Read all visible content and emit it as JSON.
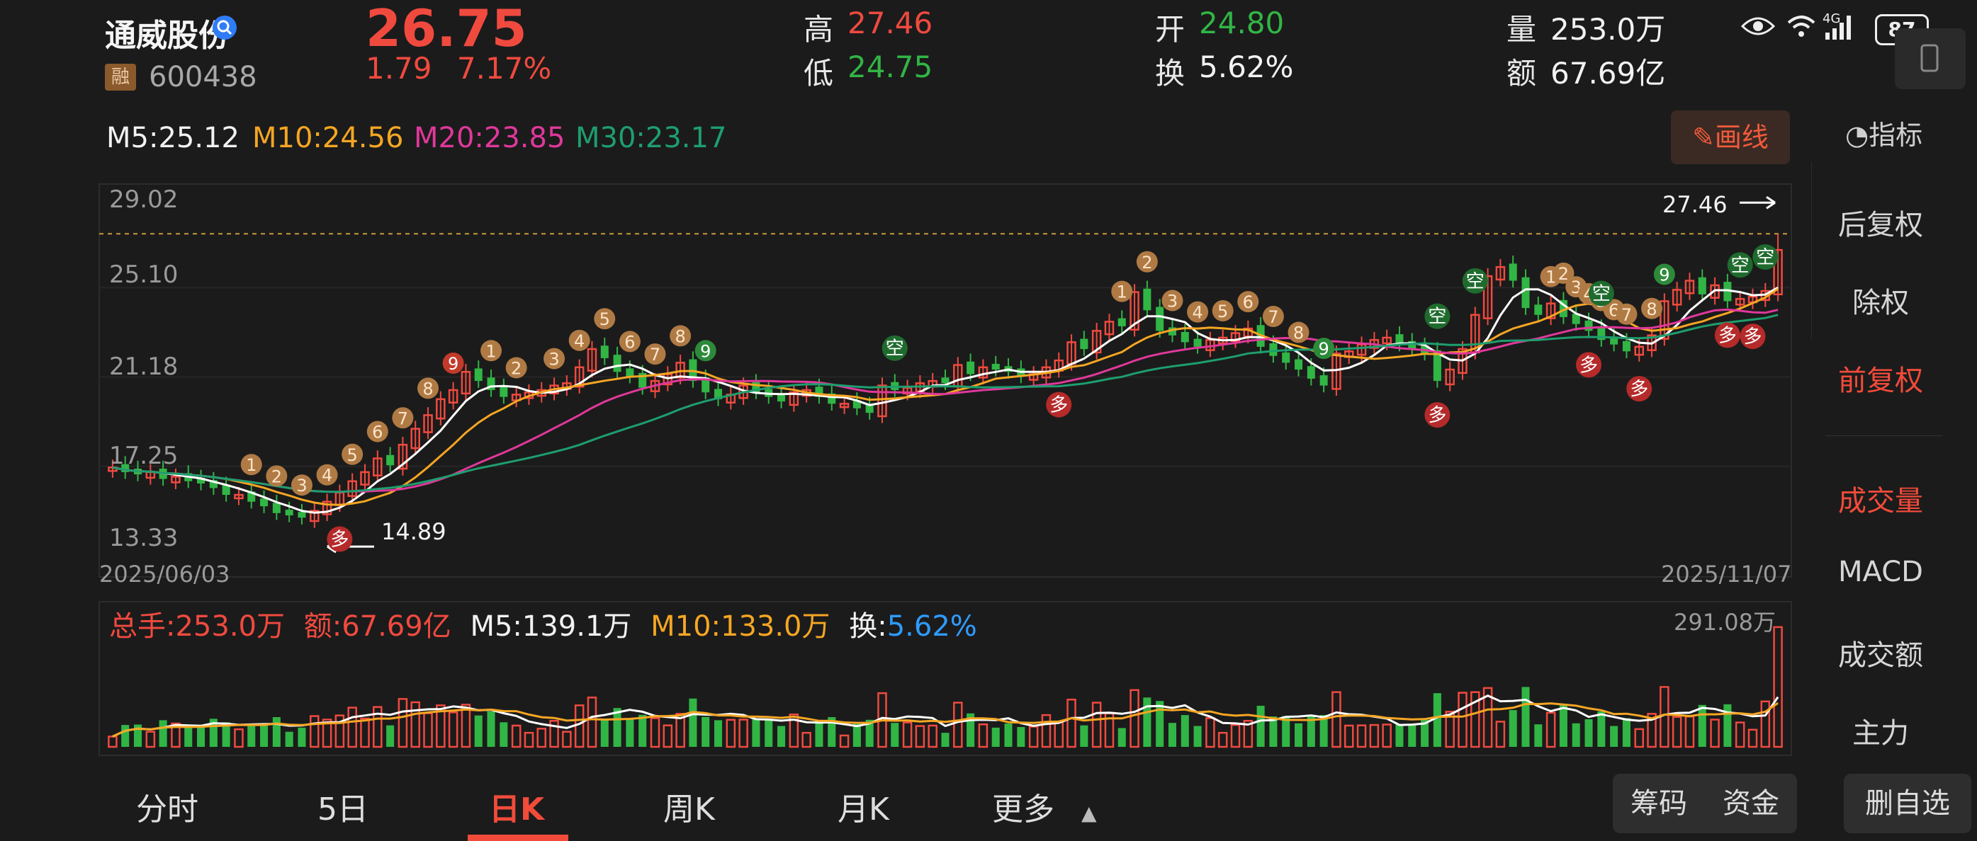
{
  "header": {
    "stock_name": "通威股份",
    "rong_badge": "融",
    "code": "600438",
    "price": "26.75",
    "change": "1.79",
    "change_pct": "7.17%",
    "high_label": "高",
    "high": "27.46",
    "low_label": "低",
    "low": "24.75",
    "open_label": "开",
    "open": "24.80",
    "turnover_label": "换",
    "turnover": "5.62%",
    "volume_label": "量",
    "volume": "253.0万",
    "amount_label": "额",
    "amount": "67.69亿"
  },
  "status_bar": {
    "network": "4G",
    "battery": "87"
  },
  "ma_line": {
    "m5": "M5:25.12",
    "m10": "M10:24.56",
    "m20": "M20:23.85",
    "m30": "M30:23.17"
  },
  "draw_line_label": "画线",
  "indicator_label": "指标",
  "right_panel": {
    "items": [
      "后复权",
      "除权",
      "前复权",
      "成交量",
      "MACD",
      "成交额",
      "主力"
    ]
  },
  "colors": {
    "up": "#f04a3f",
    "down": "#31b545",
    "m5": "#ffffff",
    "m10": "#f5a623",
    "m20": "#e0389b",
    "m30": "#1e9e6f",
    "turnover": "#2f9bff"
  },
  "chart_data": {
    "type": "candlestick",
    "y_ticks": [
      "29.02",
      "25.10",
      "21.18",
      "17.25",
      "13.33"
    ],
    "ylim": [
      13.33,
      29.02
    ],
    "start_date": "2025/06/03",
    "end_date": "2025/11/07",
    "max_label": "27.46",
    "min_label": "14.89",
    "volume_max_label": "291.08万",
    "candles_close": [
      17.2,
      17.0,
      16.9,
      17.0,
      16.7,
      16.8,
      16.6,
      16.5,
      16.3,
      16.0,
      16.0,
      15.7,
      15.5,
      15.2,
      15.1,
      15.0,
      15.3,
      15.7,
      16.1,
      16.6,
      17.0,
      17.6,
      17.3,
      18.2,
      18.9,
      19.5,
      20.2,
      20.6,
      21.4,
      21.0,
      20.6,
      20.3,
      20.4,
      20.5,
      20.6,
      20.8,
      20.9,
      21.6,
      22.4,
      22.0,
      21.4,
      21.2,
      20.7,
      21.0,
      21.3,
      21.8,
      21.0,
      20.5,
      20.2,
      20.4,
      20.8,
      20.5,
      20.3,
      20.1,
      20.5,
      20.6,
      20.3,
      20.0,
      20.0,
      19.8,
      19.6,
      20.8,
      20.6,
      20.7,
      20.9,
      21.0,
      20.9,
      21.7,
      21.3,
      21.6,
      21.5,
      21.4,
      21.2,
      21.3,
      21.6,
      21.9,
      22.7,
      22.4,
      23.2,
      23.6,
      23.4,
      24.9,
      24.1,
      23.2,
      23.0,
      22.7,
      22.5,
      22.8,
      22.9,
      23.1,
      23.3,
      22.5,
      22.1,
      21.8,
      21.5,
      21.1,
      20.8,
      22.2,
      22.3,
      22.6,
      22.8,
      22.9,
      22.6,
      22.4,
      22.2,
      21.0,
      21.5,
      22.4,
      23.9,
      25.6,
      26.0,
      25.4,
      24.2,
      23.9,
      24.4,
      23.8,
      23.5,
      23.2,
      22.8,
      22.6,
      22.3,
      22.5,
      23.0,
      24.5,
      25.0,
      25.4,
      24.8,
      25.2,
      24.5,
      24.6,
      24.7,
      24.95,
      26.75
    ],
    "candles_up": [
      1,
      0,
      0,
      1,
      0,
      1,
      0,
      0,
      0,
      0,
      1,
      0,
      0,
      0,
      0,
      0,
      1,
      1,
      1,
      1,
      1,
      1,
      0,
      1,
      1,
      1,
      1,
      1,
      1,
      0,
      0,
      0,
      1,
      1,
      1,
      1,
      1,
      1,
      1,
      0,
      0,
      0,
      0,
      1,
      1,
      1,
      0,
      0,
      0,
      1,
      1,
      0,
      0,
      0,
      1,
      1,
      0,
      0,
      1,
      0,
      0,
      1,
      0,
      1,
      1,
      1,
      0,
      1,
      0,
      1,
      0,
      0,
      0,
      1,
      1,
      1,
      1,
      0,
      1,
      1,
      0,
      1,
      0,
      0,
      0,
      0,
      0,
      1,
      1,
      1,
      1,
      0,
      0,
      0,
      0,
      0,
      0,
      1,
      1,
      1,
      1,
      1,
      0,
      0,
      0,
      0,
      1,
      1,
      1,
      1,
      1,
      0,
      0,
      0,
      1,
      0,
      0,
      0,
      0,
      0,
      0,
      1,
      1,
      1,
      1,
      1,
      0,
      1,
      0,
      1,
      1,
      1,
      1
    ],
    "volume_labels": {
      "total": "总手:253.0万",
      "amount": "额:67.69亿",
      "m5": "M5:139.1万",
      "m10": "M10:133.0万",
      "turnover_prefix": "换:",
      "turnover": "5.62%"
    },
    "signals": [
      {
        "text": "1",
        "kind": "count",
        "i": 11
      },
      {
        "text": "2",
        "kind": "count",
        "i": 13
      },
      {
        "text": "3",
        "kind": "count",
        "i": 15
      },
      {
        "text": "4",
        "kind": "count",
        "i": 17
      },
      {
        "text": "5",
        "kind": "count",
        "i": 19
      },
      {
        "text": "6",
        "kind": "count",
        "i": 21
      },
      {
        "text": "7",
        "kind": "count",
        "i": 23
      },
      {
        "text": "8",
        "kind": "count",
        "i": 25
      },
      {
        "text": "9",
        "kind": "nine-red",
        "i": 27
      },
      {
        "text": "1",
        "kind": "count",
        "i": 30
      },
      {
        "text": "2",
        "kind": "count",
        "i": 32
      },
      {
        "text": "3",
        "kind": "count",
        "i": 35
      },
      {
        "text": "4",
        "kind": "count",
        "i": 37
      },
      {
        "text": "5",
        "kind": "count",
        "i": 39
      },
      {
        "text": "6",
        "kind": "count",
        "i": 41
      },
      {
        "text": "7",
        "kind": "count",
        "i": 43
      },
      {
        "text": "8",
        "kind": "count",
        "i": 45
      },
      {
        "text": "9",
        "kind": "nine-green",
        "i": 47
      },
      {
        "text": "空",
        "kind": "short",
        "i": 62
      },
      {
        "text": "1",
        "kind": "count",
        "i": 80
      },
      {
        "text": "2",
        "kind": "count",
        "i": 82
      },
      {
        "text": "3",
        "kind": "count",
        "i": 84
      },
      {
        "text": "4",
        "kind": "count",
        "i": 86
      },
      {
        "text": "5",
        "kind": "count",
        "i": 88
      },
      {
        "text": "6",
        "kind": "count",
        "i": 90
      },
      {
        "text": "7",
        "kind": "count",
        "i": 92
      },
      {
        "text": "8",
        "kind": "count",
        "i": 94
      },
      {
        "text": "9",
        "kind": "nine-green",
        "i": 96
      },
      {
        "text": "空",
        "kind": "short",
        "i": 105
      },
      {
        "text": "空",
        "kind": "short",
        "i": 108
      },
      {
        "text": "1",
        "kind": "count",
        "i": 114
      },
      {
        "text": "2",
        "kind": "count",
        "i": 115
      },
      {
        "text": "3",
        "kind": "count",
        "i": 116
      },
      {
        "text": "4",
        "kind": "count",
        "i": 117
      },
      {
        "text": "5",
        "kind": "count",
        "i": 118
      },
      {
        "text": "6",
        "kind": "count",
        "i": 119
      },
      {
        "text": "空",
        "kind": "short",
        "i": 118
      },
      {
        "text": "7",
        "kind": "count",
        "i": 120
      },
      {
        "text": "8",
        "kind": "count",
        "i": 122
      },
      {
        "text": "9",
        "kind": "nine-green",
        "i": 123
      },
      {
        "text": "空",
        "kind": "short",
        "i": 129
      },
      {
        "text": "空",
        "kind": "short",
        "i": 131
      },
      {
        "text": "多",
        "kind": "long",
        "i": 18
      },
      {
        "text": "多",
        "kind": "long",
        "i": 75
      },
      {
        "text": "多",
        "kind": "long",
        "i": 105
      },
      {
        "text": "多",
        "kind": "long",
        "i": 117
      },
      {
        "text": "多",
        "kind": "long",
        "i": 121
      },
      {
        "text": "多",
        "kind": "long",
        "i": 128
      },
      {
        "text": "多",
        "kind": "long",
        "i": 130
      }
    ]
  },
  "bottom_nav": {
    "tabs": [
      "分时",
      "5日",
      "日K",
      "周K",
      "月K",
      "更多"
    ],
    "active": "日K",
    "chip": "筹码",
    "funds": "资金",
    "remove_watch": "删自选"
  }
}
